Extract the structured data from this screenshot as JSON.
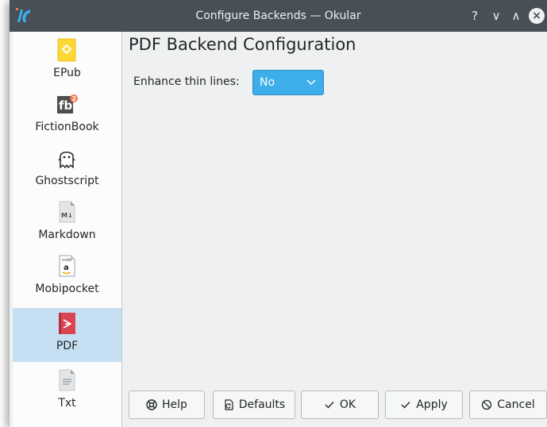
{
  "window": {
    "title": "Configure Backends — Okular",
    "help_glyph": "?",
    "minimize_glyph": "∨",
    "maximize_glyph": "∧",
    "close_glyph": "×"
  },
  "sidebar": {
    "items": [
      {
        "label": "EPub",
        "icon": "epub-icon"
      },
      {
        "label": "FictionBook",
        "icon": "fictionbook-icon"
      },
      {
        "label": "Ghostscript",
        "icon": "ghost-icon"
      },
      {
        "label": "Markdown",
        "icon": "markdown-icon"
      },
      {
        "label": "Mobipocket",
        "icon": "mobipocket-icon"
      },
      {
        "label": "PDF",
        "icon": "pdf-icon"
      },
      {
        "label": "Txt",
        "icon": "text-file-icon"
      }
    ],
    "selected": "PDF"
  },
  "icons": {
    "fb_text": "fb",
    "fb_badge": "2",
    "markdown_text": "M↓",
    "mobi_top": "mobi",
    "mobi_letter": "a"
  },
  "page": {
    "title": "PDF Backend Configuration",
    "enhance_label": "Enhance thin lines:",
    "enhance_value": "No"
  },
  "buttons": {
    "help": "Help",
    "defaults": "Defaults",
    "ok": "OK",
    "apply": "Apply",
    "cancel": "Cancel"
  },
  "colors": {
    "titlebar": "#475057",
    "accent": "#3daee9",
    "selection": "#c7dff2",
    "background": "#eff0f1"
  }
}
